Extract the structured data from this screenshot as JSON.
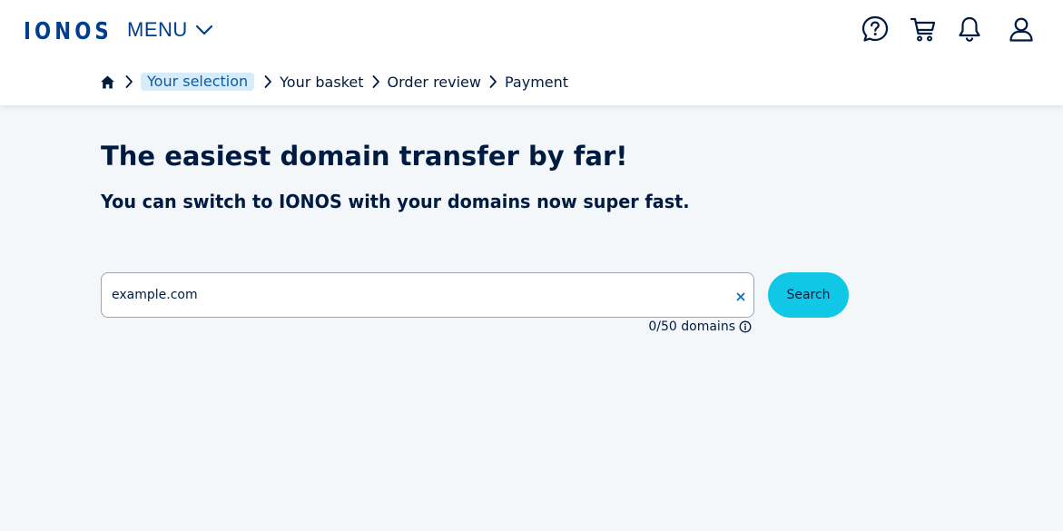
{
  "header": {
    "logo": "IONOS",
    "menu_label": "MENU",
    "icons": [
      "help-icon",
      "cart-icon",
      "bell-icon",
      "user-icon"
    ]
  },
  "breadcrumb": {
    "home_icon": "home-icon",
    "items": [
      "Your selection",
      "Your basket",
      "Order review",
      "Payment"
    ]
  },
  "main": {
    "title": "The easiest domain transfer by far!",
    "subtitle": "You can switch to IONOS with your domains now super fast.",
    "search": {
      "value": "example.com",
      "button_label": "Search",
      "counter": "0/50 domains"
    }
  },
  "colors": {
    "brand": "#003d8f",
    "text": "#001b41",
    "accent": "#11c7e6",
    "page_bg": "#f4f7fa",
    "active_crumb_bg": "#d6ecfa"
  }
}
